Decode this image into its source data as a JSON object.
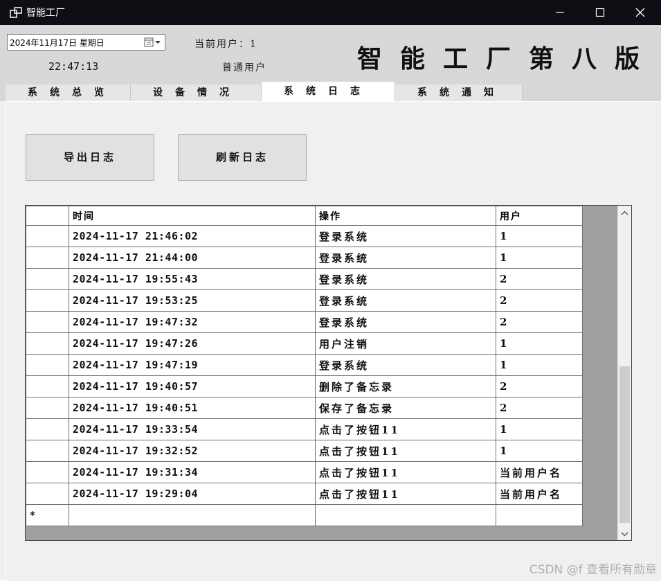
{
  "window": {
    "title": "智能工厂",
    "controls": {
      "minimize": "minimize",
      "maximize": "maximize",
      "close": "close"
    }
  },
  "header": {
    "date_value": "2024年11月17日 星期日",
    "clock": "22:47:13",
    "current_user_line": "当前用户：1",
    "user_role": "普通用户",
    "big_title": "智能工厂第八版"
  },
  "tabs": [
    {
      "label": "系统总览",
      "active": false
    },
    {
      "label": "设备情况",
      "active": false
    },
    {
      "label": "系统日志",
      "active": true
    },
    {
      "label": "系统通知",
      "active": false
    }
  ],
  "actions": {
    "export_label": "导出日志",
    "refresh_label": "刷新日志"
  },
  "log_table": {
    "headers": [
      "时间",
      "操作",
      "用户"
    ],
    "rows": [
      {
        "time": "2024-11-17 21:46:02",
        "op": "登录系统",
        "user": "1"
      },
      {
        "time": "2024-11-17 21:44:00",
        "op": "登录系统",
        "user": "1"
      },
      {
        "time": "2024-11-17 19:55:43",
        "op": "登录系统",
        "user": "2"
      },
      {
        "time": "2024-11-17 19:53:25",
        "op": "登录系统",
        "user": "2"
      },
      {
        "time": "2024-11-17 19:47:32",
        "op": "登录系统",
        "user": "2"
      },
      {
        "time": "2024-11-17 19:47:26",
        "op": "用户注销",
        "user": "1"
      },
      {
        "time": "2024-11-17 19:47:19",
        "op": "登录系统",
        "user": "1"
      },
      {
        "time": "2024-11-17 19:40:57",
        "op": "删除了备忘录",
        "user": "2"
      },
      {
        "time": "2024-11-17 19:40:51",
        "op": "保存了备忘录",
        "user": "2"
      },
      {
        "time": "2024-11-17 19:33:54",
        "op": "点击了按钮11",
        "user": "1"
      },
      {
        "time": "2024-11-17 19:32:52",
        "op": "点击了按钮11",
        "user": "1"
      },
      {
        "time": "2024-11-17 19:31:34",
        "op": "点击了按钮11",
        "user": "当前用户名"
      },
      {
        "time": "2024-11-17 19:29:04",
        "op": "点击了按钮11",
        "user": "当前用户名"
      }
    ],
    "new_row_marker": "*"
  },
  "watermark": "CSDN @f 查看所有勋章",
  "colors": {
    "titlebar": "#0e0e14",
    "header_bg": "#d8d8d8",
    "panel_bg": "#f0f0f0",
    "grid_bg": "#a0a0a0"
  }
}
